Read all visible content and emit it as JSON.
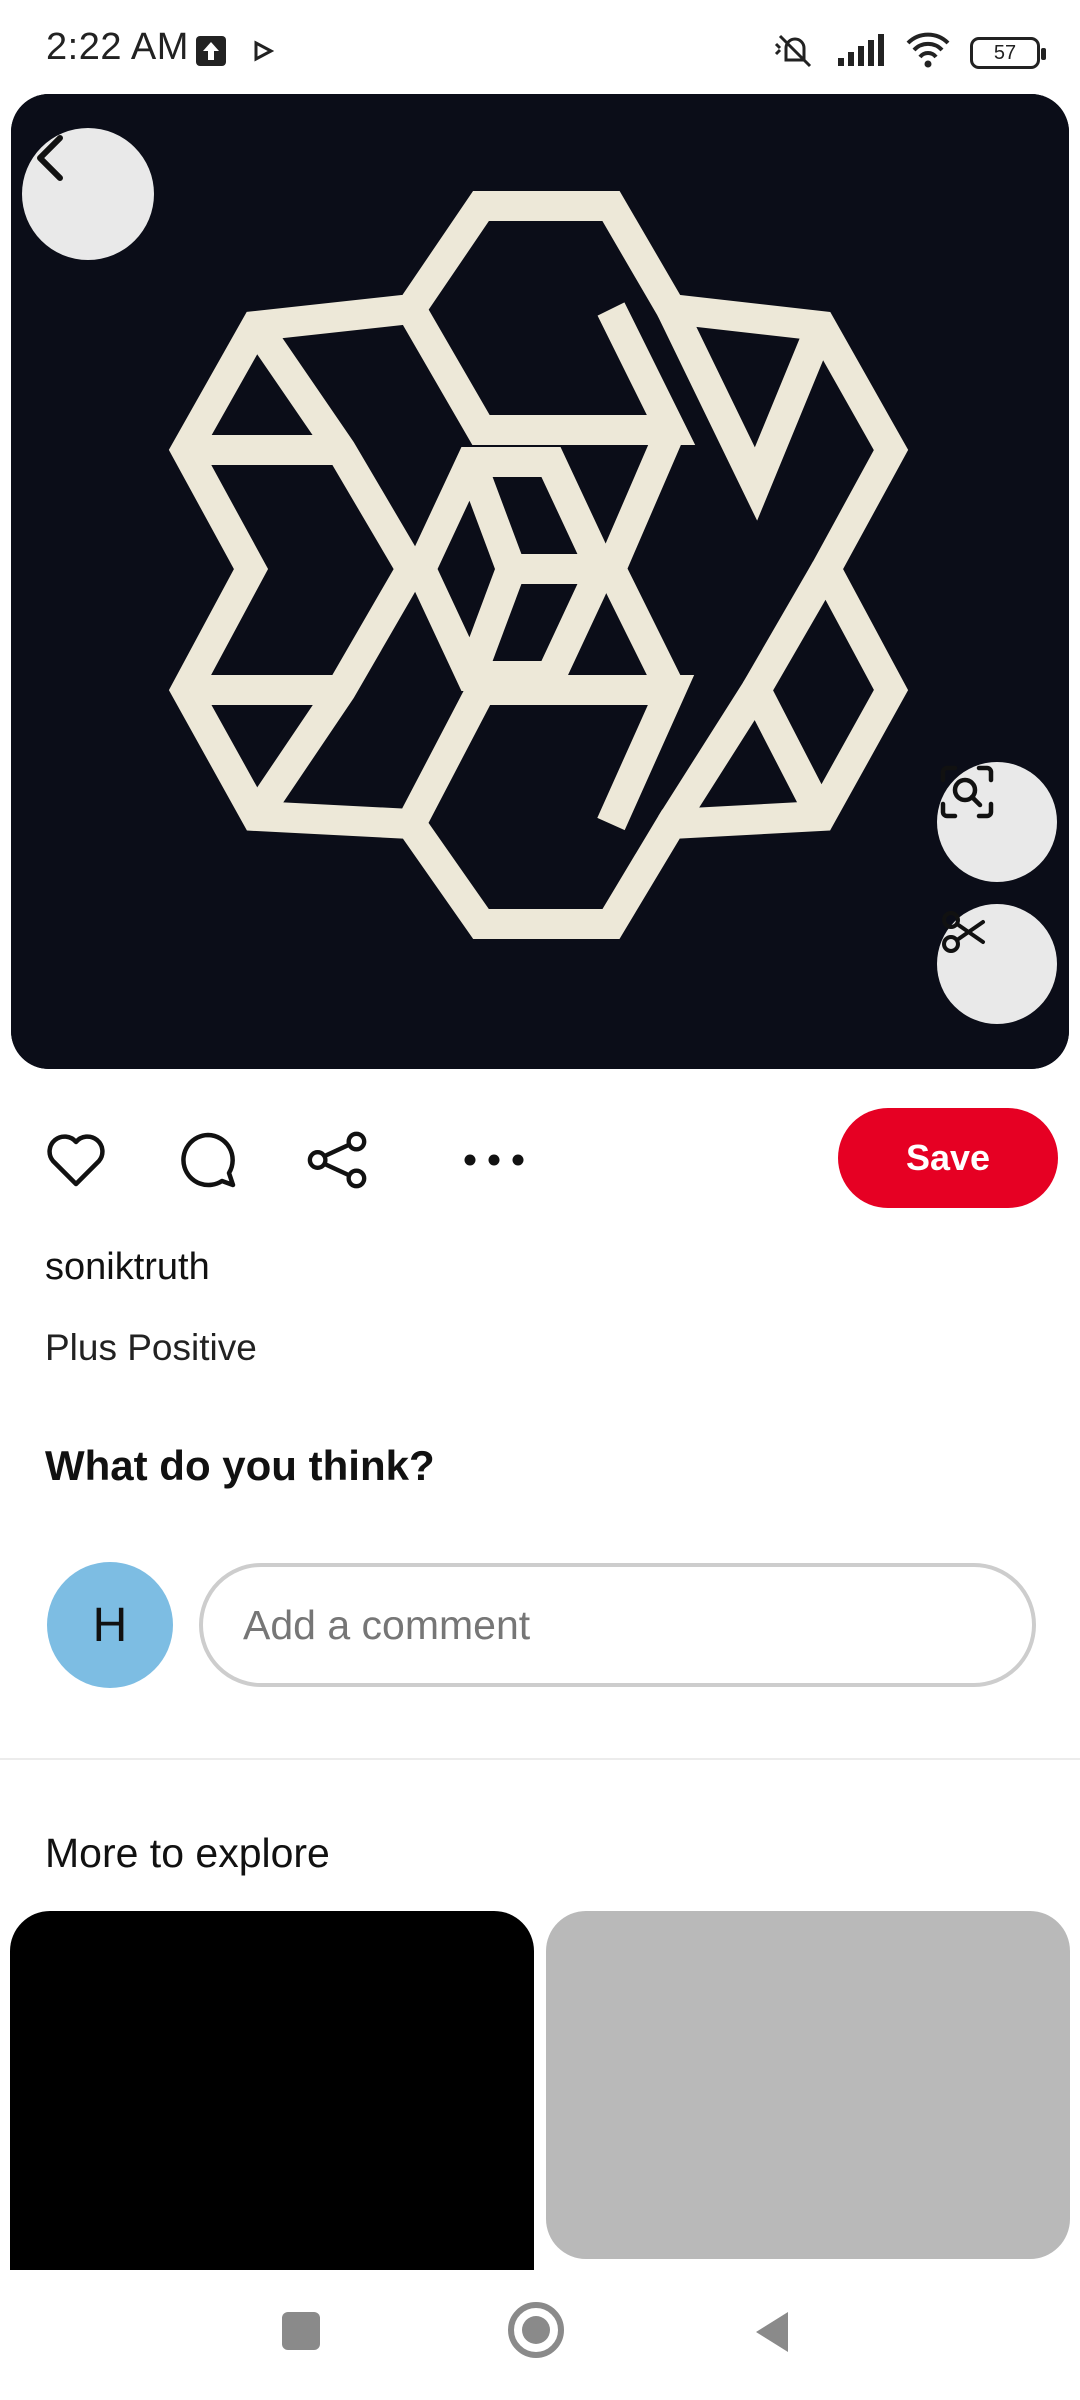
{
  "status_bar": {
    "time": "2:22 AM",
    "battery": "57",
    "icons": [
      "upload-icon",
      "play-icon",
      "mute-icon",
      "signal-icon",
      "wifi-icon",
      "battery-icon"
    ]
  },
  "pin": {
    "image_alt_icon": "hexagonal-plus-pattern",
    "username": "soniktruth",
    "title": "Plus Positive"
  },
  "actions": {
    "save_label": "Save",
    "icons": [
      "heart-icon",
      "comment-icon",
      "share-icon",
      "more-icon"
    ]
  },
  "comments": {
    "heading": "What do you think?",
    "avatar_initial": "H",
    "placeholder": "Add a comment"
  },
  "explore": {
    "heading": "More to explore"
  },
  "colors": {
    "brand_red": "#e60023",
    "avatar_blue": "#7dbde3",
    "image_bg": "#0b0d18",
    "pattern": "#ede8d8"
  }
}
